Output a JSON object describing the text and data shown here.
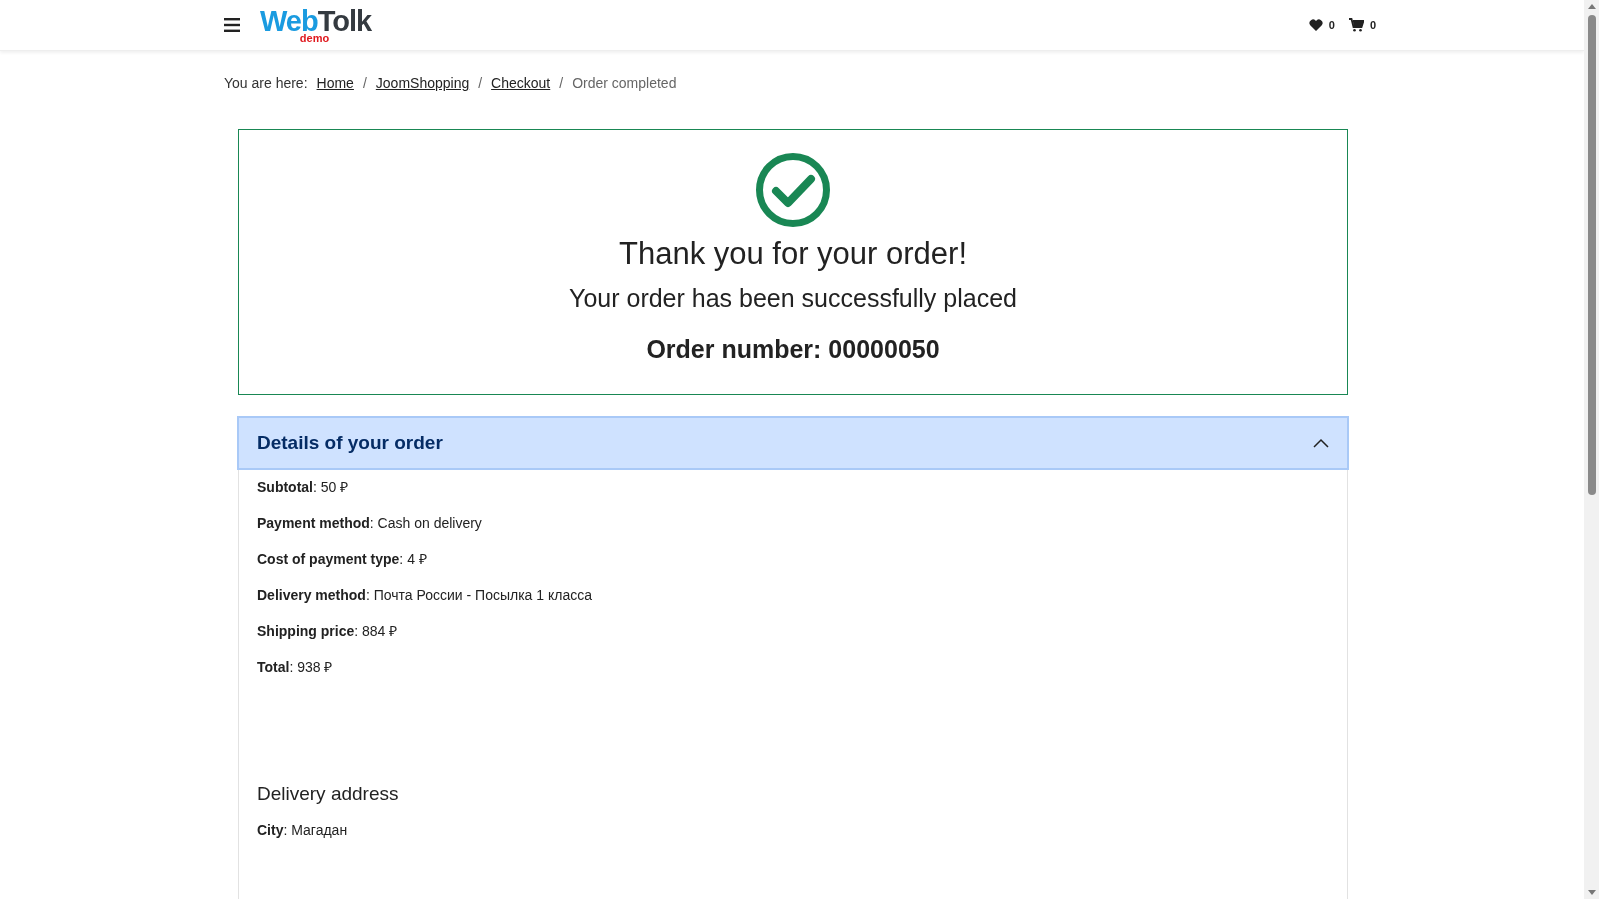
{
  "header": {
    "logo": {
      "part_1": "Web",
      "part_2": "Tolk",
      "tagline": "demo"
    },
    "wishlist_count": "0",
    "cart_count": "0"
  },
  "breadcrumbs": {
    "label": "You are here:",
    "separator": "/",
    "items": [
      {
        "text": "Home",
        "current": false
      },
      {
        "text": "JoomShopping",
        "current": false
      },
      {
        "text": "Checkout",
        "current": false
      },
      {
        "text": "Order completed",
        "current": true
      }
    ]
  },
  "confirmation": {
    "title": "Thank you for your order!",
    "subtitle": "Your order has been successfully placed",
    "order_number": "Order number: 00000050"
  },
  "details": {
    "title": "Details of your order",
    "expanded": true,
    "lines": [
      "**Subtotal**: 50 ₽",
      "**Payment method**: Cash on delivery",
      "**Cost of payment type**: 4 ₽",
      "**Delivery method**: Почта России - Посылка 1 класса",
      "**Shipping price**: 884 ₽",
      "**Total**: 938 ₽"
    ],
    "address_title": "Delivery address",
    "address_lines": [
      "**City**: Магадан"
    ]
  }
}
